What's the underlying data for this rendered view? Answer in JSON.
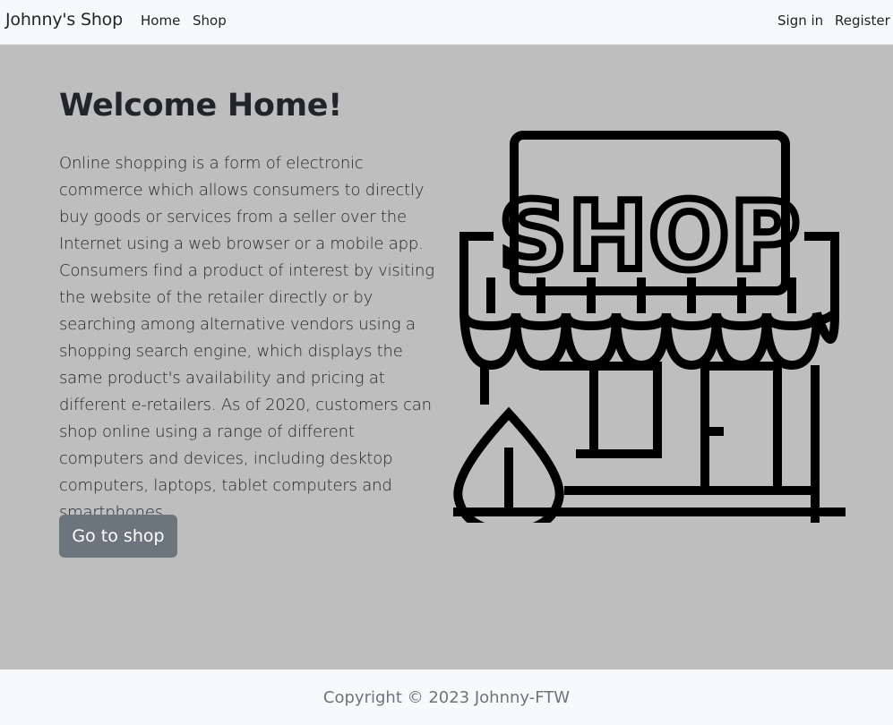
{
  "navbar": {
    "brand": "Johnny's Shop",
    "links": [
      "Home",
      "Shop"
    ],
    "auth": [
      "Sign in",
      "Register"
    ]
  },
  "hero": {
    "title": "Welcome Home!",
    "paragraph": "Online shopping is a form of electronic commerce which allows consumers to directly buy goods or services from a seller over the Internet using a web browser or a mobile app. Consumers find a product of interest by visiting the website of the retailer directly or by searching among alternative vendors using a shopping search engine, which displays the same product's availability and pricing at different e-retailers. As of 2020, customers can shop online using a range of different computers and devices, including desktop computers, laptops, tablet computers and smartphones.",
    "button_label": "Go to shop",
    "illustration": {
      "icon": "storefront-icon",
      "sign_text": "SHOP"
    }
  },
  "footer": {
    "copyright": "Copyright © 2023 Johnny-FTW"
  },
  "colors": {
    "navbar_bg": "#f8f9fa",
    "hero_bg": "#bebebe",
    "button_bg": "#6c757d",
    "footer_text": "#6c757d"
  }
}
